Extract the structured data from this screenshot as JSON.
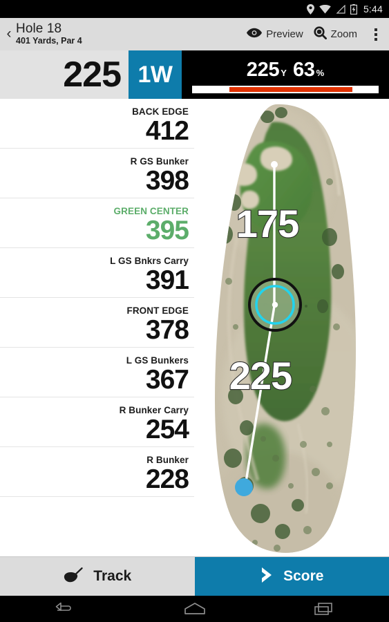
{
  "status_bar": {
    "time": "5:44",
    "icons": [
      "location-pin-icon",
      "wifi-icon",
      "signal-icon",
      "battery-charging-icon"
    ]
  },
  "app_bar": {
    "back_label": "‹",
    "hole_title": "Hole 18",
    "hole_subtitle": "401 Yards, Par 4",
    "preview_label": "Preview",
    "zoom_label": "Zoom",
    "overflow_label": "More options"
  },
  "yardage_bar": {
    "distance": "225",
    "club": "1W",
    "shot_distance": "225",
    "shot_distance_unit": "Y",
    "shot_percent": "63",
    "shot_percent_unit": "%",
    "bar_start_pct": 20,
    "bar_end_pct": 86,
    "bar_color": "#e03100",
    "club_color": "#0e7cab"
  },
  "distances": {
    "green_color": "#5cad6a",
    "rows": [
      {
        "label": "BACK EDGE",
        "value": "412",
        "highlight": false
      },
      {
        "label": "R GS Bunker",
        "value": "398",
        "highlight": false
      },
      {
        "label": "GREEN CENTER",
        "value": "395",
        "highlight": true
      },
      {
        "label": "L GS Bnkrs Carry",
        "value": "391",
        "highlight": false
      },
      {
        "label": "FRONT EDGE",
        "value": "378",
        "highlight": false
      },
      {
        "label": "L GS Bunkers",
        "value": "367",
        "highlight": false
      },
      {
        "label": "R Bunker Carry",
        "value": "254",
        "highlight": false
      },
      {
        "label": "R Bunker",
        "value": "228",
        "highlight": false
      }
    ]
  },
  "map": {
    "label_to_pin": "175",
    "label_to_target": "225",
    "target_ring_color": "#22d3ee",
    "player_marker_color": "#3fa9dd",
    "pin_marker_color": "#ffffff"
  },
  "bottom_actions": {
    "track_label": "Track",
    "track_icon": "golf-driver-icon",
    "score_label": "Score",
    "score_icon": "chevron-right-icon",
    "score_color": "#0e7cab"
  },
  "nav_bar": {
    "back": "back-nav-icon",
    "home": "home-nav-icon",
    "recents": "recents-nav-icon"
  }
}
